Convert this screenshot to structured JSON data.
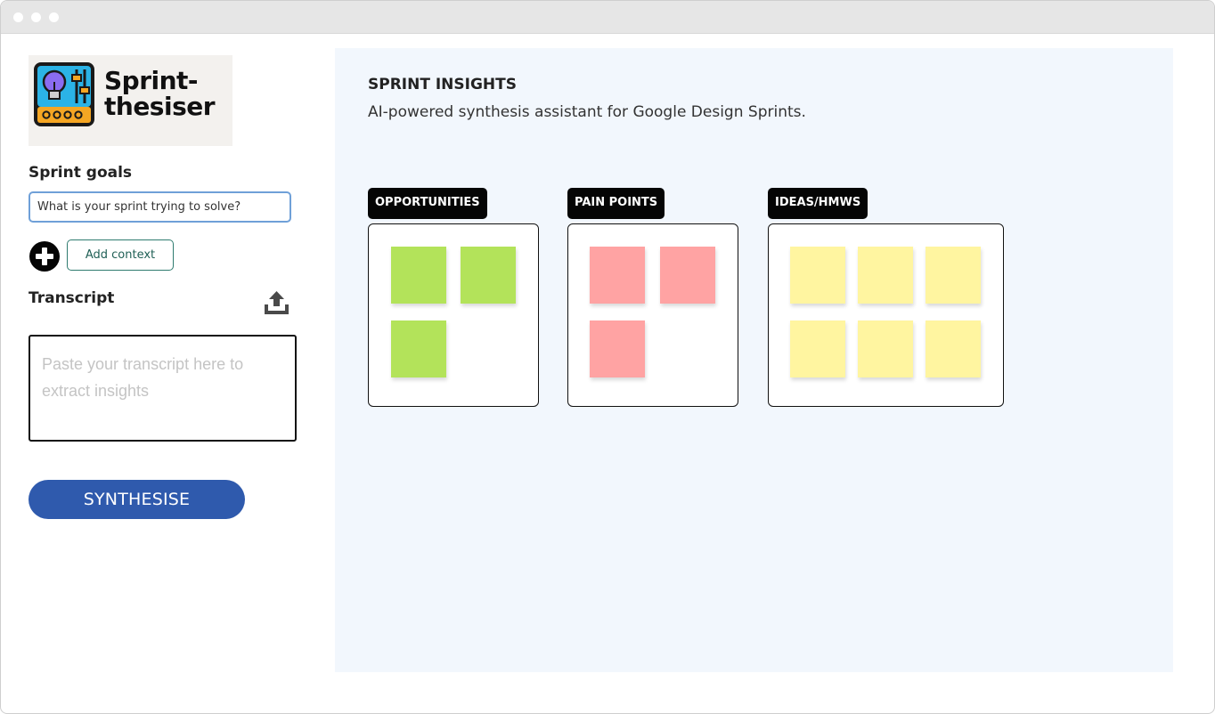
{
  "app": {
    "logo_line1": "Sprint-",
    "logo_line2": "thesiser"
  },
  "sidebar": {
    "goals_label": "Sprint goals",
    "goals_placeholder": "What is your sprint trying to solve?",
    "add_context_label": "Add context",
    "transcript_label": "Transcript",
    "transcript_placeholder": "Paste your transcript here to extract insights",
    "synthesise_label": "SYNTHESISE"
  },
  "main": {
    "title": "SPRINT INSIGHTS",
    "subtitle": "AI-powered synthesis assistant for Google Design Sprints.",
    "columns": [
      {
        "label": "OPPORTUNITIES",
        "note_color": "#b3e35a",
        "note_count": 3
      },
      {
        "label": "PAIN POINTS",
        "note_color": "#ffa3a3",
        "note_count": 3
      },
      {
        "label": "IDEAS/HMWS",
        "note_color": "#fff5a0",
        "note_count": 6
      }
    ]
  },
  "colors": {
    "accent": "#2f5aad",
    "panel_bg": "#f2f7fd",
    "input_border": "#6fa0d8",
    "context_border": "#2f7b6f"
  },
  "icons": [
    "lightbulb-mixer-logo-icon",
    "plus-circle-icon",
    "upload-icon"
  ]
}
